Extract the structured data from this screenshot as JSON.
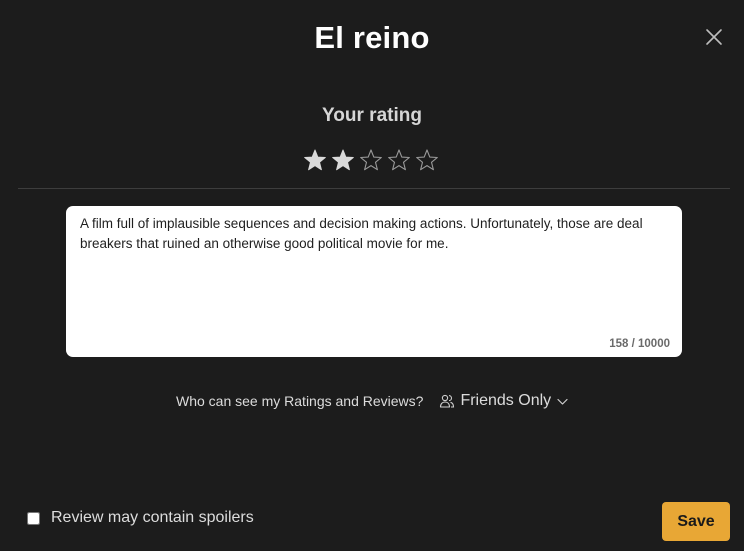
{
  "dialog": {
    "title": "El reino",
    "close_icon": "close-icon"
  },
  "rating": {
    "label": "Your rating",
    "value": 2,
    "max": 5,
    "filled_color": "#d9d9d9",
    "empty_color": "#9a9a9a"
  },
  "review": {
    "text": "A film full of implausible sequences and decision making actions. Unfortunately, those are deal breakers that ruined an otherwise good political movie for me.",
    "counter": "158 / 10000"
  },
  "visibility": {
    "label": "Who can see my Ratings and Reviews?",
    "icon": "people-icon",
    "value": "Friends Only",
    "dropdown_icon": "chevron-down-icon"
  },
  "spoiler": {
    "label": "Review may contain spoilers",
    "checked": false
  },
  "actions": {
    "save_label": "Save",
    "accent_color": "#e8a735"
  }
}
